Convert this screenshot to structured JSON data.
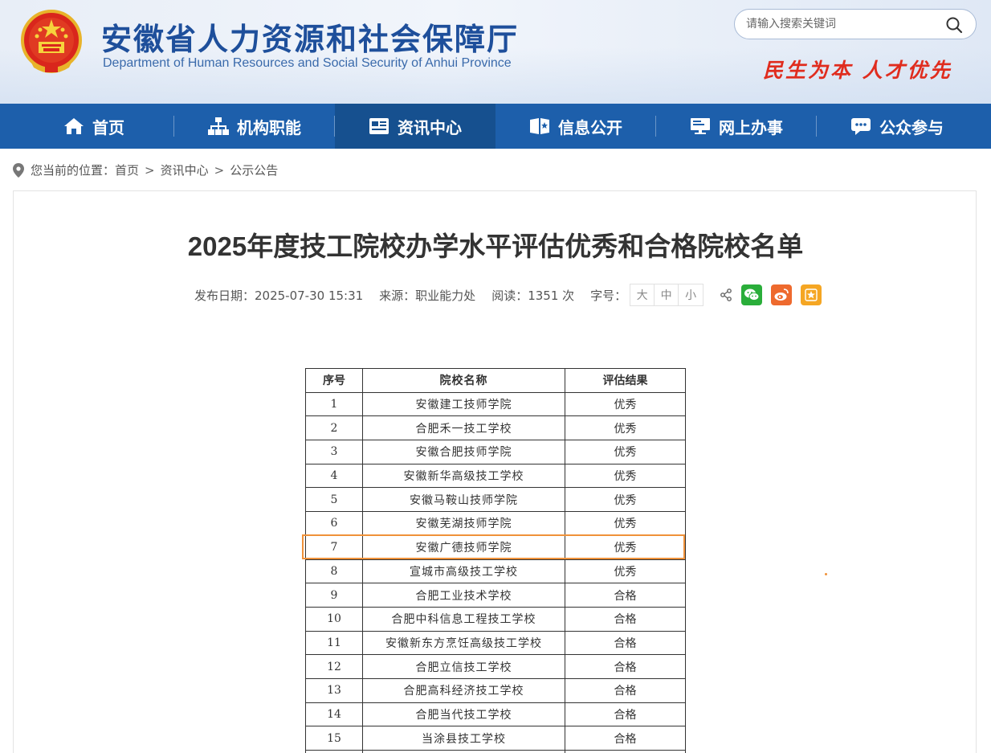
{
  "header": {
    "site_title": "安徽省人力资源和社会保障厅",
    "site_subtitle": "Department of Human Resources and Social Security of Anhui Province",
    "slogan": "民生为本  人才优先",
    "search_placeholder": "请输入搜索关键词",
    "emblem_icon": "national-emblem-icon",
    "search_icon": "search-icon"
  },
  "nav": {
    "items": [
      {
        "label": "首页",
        "icon": "home-icon"
      },
      {
        "label": "机构职能",
        "icon": "org-chart-icon"
      },
      {
        "label": "资讯中心",
        "icon": "news-icon",
        "active": true
      },
      {
        "label": "信息公开",
        "icon": "open-info-icon"
      },
      {
        "label": "网上办事",
        "icon": "online-service-icon"
      },
      {
        "label": "公众参与",
        "icon": "public-participation-icon"
      }
    ],
    "bg_color": "#1d5fab",
    "active_color": "#16508f"
  },
  "breadcrumb": {
    "prefix": "您当前的位置：",
    "items": [
      "首页",
      "资讯中心",
      "公示公告"
    ],
    "separator": ">"
  },
  "article": {
    "title": "2025年度技工院校办学水平评估优秀和合格院校名单",
    "publish_date": "发布日期：2025-07-30 15:31",
    "source": "来源：职业能力处",
    "reads": "阅读：1351 次",
    "font_size_label": "字号：",
    "font_sizes": [
      "大",
      "中",
      "小"
    ]
  },
  "share": {
    "icons": [
      "share-icon",
      "wechat-icon",
      "weibo-icon",
      "favorite-icon"
    ],
    "colors": {
      "wechat": "#2aae3a",
      "weibo": "#ee6a2e",
      "favorite": "#f5a623"
    }
  },
  "table": {
    "headers": [
      "序号",
      "院校名称",
      "评估结果"
    ],
    "rows": [
      [
        "1",
        "安徽建工技师学院",
        "优秀"
      ],
      [
        "2",
        "合肥禾一技工学校",
        "优秀"
      ],
      [
        "3",
        "安徽合肥技师学院",
        "优秀"
      ],
      [
        "4",
        "安徽新华高级技工学校",
        "优秀"
      ],
      [
        "5",
        "安徽马鞍山技师学院",
        "优秀"
      ],
      [
        "6",
        "安徽芜湖技师学院",
        "优秀"
      ],
      [
        "7",
        "安徽广德技师学院",
        "优秀"
      ],
      [
        "8",
        "宣城市高级技工学校",
        "优秀"
      ],
      [
        "9",
        "合肥工业技术学校",
        "合格"
      ],
      [
        "10",
        "合肥中科信息工程技工学校",
        "合格"
      ],
      [
        "11",
        "安徽新东方烹饪高级技工学校",
        "合格"
      ],
      [
        "12",
        "合肥立信技工学校",
        "合格"
      ],
      [
        "13",
        "合肥高科经济技工学校",
        "合格"
      ],
      [
        "14",
        "合肥当代技工学校",
        "合格"
      ],
      [
        "15",
        "当涂县技工学校",
        "合格"
      ],
      [
        "",
        "",
        ""
      ]
    ],
    "highlight_color": "#f0923a"
  }
}
